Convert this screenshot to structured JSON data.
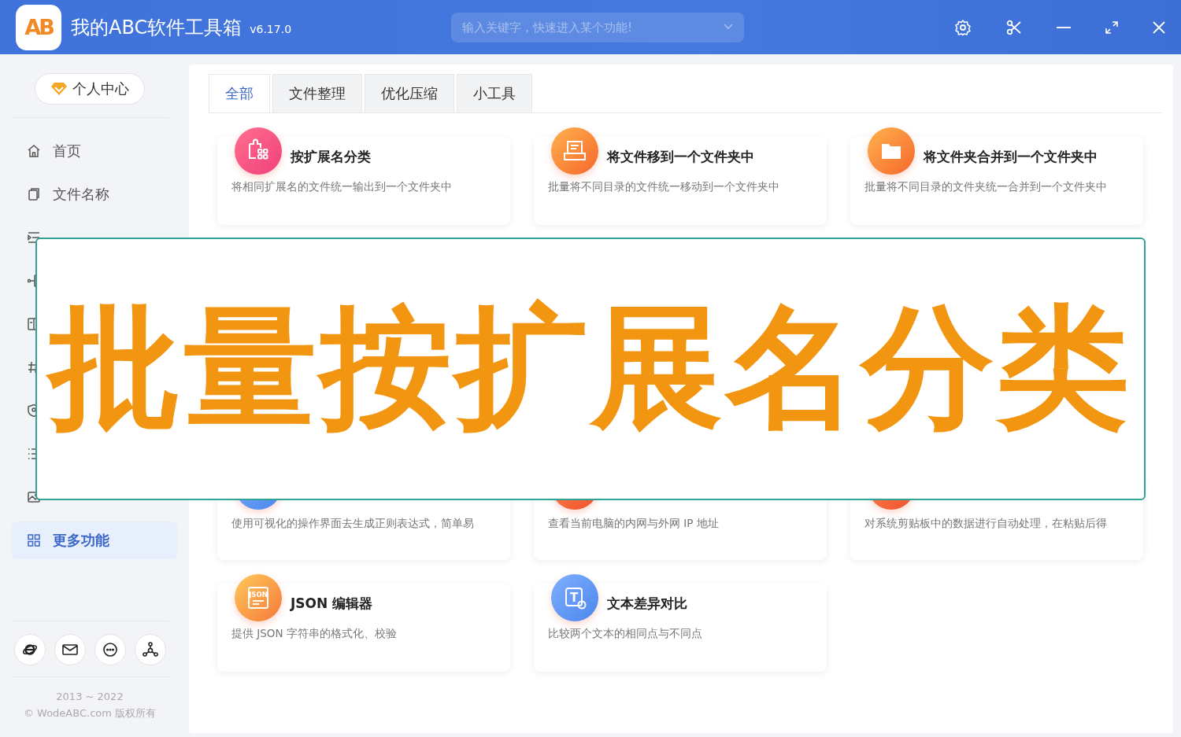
{
  "window": {
    "logo": "AB",
    "title": "我的ABC软件工具箱",
    "version": "v6.17.0"
  },
  "search": {
    "placeholder": "输入关键字，快速进入某个功能!"
  },
  "sidebar": {
    "profile_button": "个人中心",
    "items": [
      {
        "label": "首页",
        "selected": false
      },
      {
        "label": "文件名称",
        "selected": false
      },
      {
        "selected": false
      },
      {
        "selected": false
      },
      {
        "selected": false
      },
      {
        "selected": false
      },
      {
        "selected": false
      },
      {
        "selected": false
      },
      {
        "selected": false
      },
      {
        "label": "更多功能",
        "selected": true
      }
    ],
    "years": "2013 ~ 2022",
    "copyright": "© WodeABC.com 版权所有"
  },
  "tabs": [
    {
      "label": "全部",
      "selected": true
    },
    {
      "label": "文件整理",
      "selected": false
    },
    {
      "label": "优化压缩",
      "selected": false
    },
    {
      "label": "小工具",
      "selected": false
    }
  ],
  "cards": [
    {
      "title": "按扩展名分类",
      "description": "将相同扩展名的文件统一输出到一个文件夹中"
    },
    {
      "title": "将文件移到一个文件夹中",
      "description": "批量将不同目录的文件统一移动到一个文件夹中"
    },
    {
      "title": "将文件夹合并到一个文件夹中",
      "description": "批量将不同目录的文件夹统一合并到一个文件夹中"
    }
  ],
  "partly_covered_cards": [
    {
      "description": "使用可视化的操作界面去生成正则表达式，简单易"
    },
    {
      "description": "查看当前电脑的内网与外网 IP 地址"
    },
    {
      "description": "对系统剪贴板中的数据进行自动处理，在粘贴后得"
    }
  ],
  "bottom_cards": [
    {
      "icon_text": "JSON",
      "title": "JSON 编辑器",
      "description": "提供 JSON 字符串的格式化、校验"
    },
    {
      "icon_text": "T",
      "title": "文本差异对比",
      "description": "比较两个文本的相同点与不同点"
    }
  ],
  "banner": {
    "text": "批量按扩展名分类"
  }
}
